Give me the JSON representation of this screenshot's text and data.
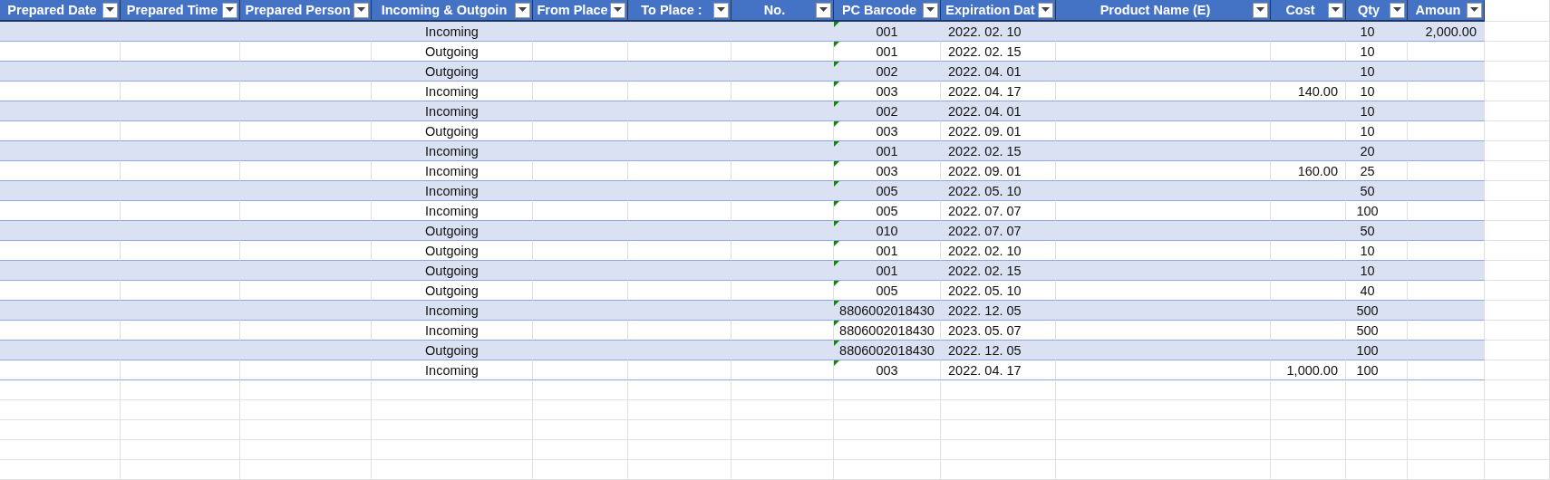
{
  "table": {
    "columns": [
      "Prepared Date",
      "Prepared Time",
      "Prepared Person",
      "Incoming & Outgoin",
      "From Place",
      "To Place :",
      "No.",
      "PC Barcode",
      "Expiration Dat",
      "Product Name (E)",
      "Cost",
      "Qty",
      "Amoun"
    ],
    "rows": [
      {
        "direction": "Incoming",
        "barcode": "001",
        "expiration": "2022. 02. 10",
        "qty": "10",
        "amount": "2,000.00"
      },
      {
        "direction": "Outgoing",
        "barcode": "001",
        "expiration": "2022. 02. 15",
        "qty": "10"
      },
      {
        "direction": "Outgoing",
        "barcode": "002",
        "expiration": "2022. 04. 01",
        "qty": "10"
      },
      {
        "direction": "Incoming",
        "barcode": "003",
        "expiration": "2022. 04. 17",
        "cost": "140.00",
        "qty": "10"
      },
      {
        "direction": "Incoming",
        "barcode": "002",
        "expiration": "2022. 04. 01",
        "qty": "10"
      },
      {
        "direction": "Outgoing",
        "barcode": "003",
        "expiration": "2022. 09. 01",
        "qty": "10"
      },
      {
        "direction": "Incoming",
        "barcode": "001",
        "expiration": "2022. 02. 15",
        "qty": "20"
      },
      {
        "direction": "Incoming",
        "barcode": "003",
        "expiration": "2022. 09. 01",
        "cost": "160.00",
        "qty": "25"
      },
      {
        "direction": "Incoming",
        "barcode": "005",
        "expiration": "2022. 05. 10",
        "qty": "50"
      },
      {
        "direction": "Incoming",
        "barcode": "005",
        "expiration": "2022. 07. 07",
        "qty": "100"
      },
      {
        "direction": "Outgoing",
        "barcode": "010",
        "expiration": "2022. 07. 07",
        "qty": "50"
      },
      {
        "direction": "Outgoing",
        "barcode": "001",
        "expiration": "2022. 02. 10",
        "qty": "10"
      },
      {
        "direction": "Outgoing",
        "barcode": "001",
        "expiration": "2022. 02. 15",
        "qty": "10"
      },
      {
        "direction": "Outgoing",
        "barcode": "005",
        "expiration": "2022. 05. 10",
        "qty": "40"
      },
      {
        "direction": "Incoming",
        "barcode": "8806002018430",
        "expiration": "2022. 12. 05",
        "qty": "500"
      },
      {
        "direction": "Incoming",
        "barcode": "8806002018430",
        "expiration": "2023. 05. 07",
        "qty": "500"
      },
      {
        "direction": "Outgoing",
        "barcode": "8806002018430",
        "expiration": "2022. 12. 05",
        "qty": "100"
      },
      {
        "direction": "Incoming",
        "barcode": "003",
        "expiration": "2022. 04. 17",
        "cost": "1,000.00",
        "qty": "100"
      }
    ]
  }
}
